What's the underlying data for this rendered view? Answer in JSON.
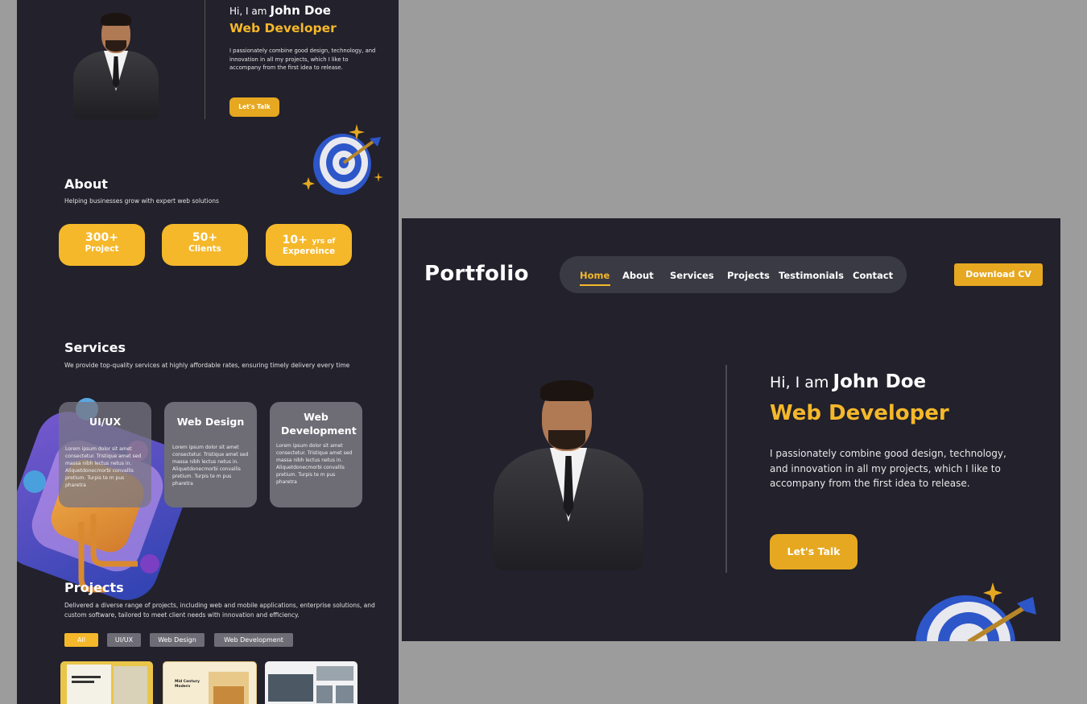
{
  "mobile": {
    "hero": {
      "greeting": "Hi, I am",
      "name": "John Doe",
      "role": "Web Developer",
      "intro": "I passionately combine good design, technology, and innovation in all my projects, which I like to accompany from the first idea to release.",
      "cta": "Let's Talk"
    },
    "about": {
      "title": "About",
      "subtitle": "Helping businesses grow with expert web solutions",
      "stats": [
        {
          "value": "300+",
          "label": "Project"
        },
        {
          "value": "50+",
          "label": "Clients"
        },
        {
          "value": "10+",
          "suffix": "yrs of",
          "label": "Expereince"
        }
      ]
    },
    "services": {
      "title": "Services",
      "subtitle": "We provide top-quality services at highly affordable rates, ensuring timely delivery every time",
      "cards": [
        {
          "title": "UI/UX",
          "body": "Lorem ipsum dolor sit amet consectetur. Tristique amet sed massa nibh lectus netus in. Aliquetdonecmorbi convallis pretium. Turpis te m pus pharetra"
        },
        {
          "title": "Web Design",
          "body": "Lorem ipsum dolor sit amet consectetur. Tristique amet sed massa nibh lectus netus in. Aliquetdonecmorbi convallis pretium. Turpis te m pus pharetra"
        },
        {
          "title": "Web Development",
          "body": "Lorem ipsum dolor sit amet consectetur. Tristique amet sed massa nibh lectus netus in. Aliquetdonecmorbi convallis pretium. Turpis te m pus pharetra"
        }
      ]
    },
    "projects": {
      "title": "Projects",
      "subtitle": "Delivered a diverse range of projects, including web and mobile applications, enterprise solutions, and custom software, tailored to meet client needs with innovation and efficiency.",
      "filters": [
        "All",
        "UI/UX",
        "Web Design",
        "Web Development"
      ],
      "thumb_captions": [
        "",
        "Mid Century Modern",
        ""
      ]
    }
  },
  "desktop": {
    "logo": "Portfolio",
    "nav": [
      "Home",
      "About",
      "Services",
      "Projects",
      "Testimonials",
      "Contact"
    ],
    "active_nav": "Home",
    "download": "Download CV",
    "hero": {
      "greeting": "Hi, I am",
      "name": "John Doe",
      "role": "Web Developer",
      "intro": "I passionately combine good design, technology, and innovation in all my projects, which I like to accompany from the first idea to release.",
      "cta": "Let's Talk"
    }
  },
  "colors": {
    "background": "#9c9c9c",
    "panel": "#22212c",
    "accent": "#f5b82a",
    "button": "#e6a820",
    "card": "#6e6d76"
  },
  "icons": [
    "target-dart-icon",
    "sparkle-icon",
    "3d-circuit-illustration"
  ]
}
